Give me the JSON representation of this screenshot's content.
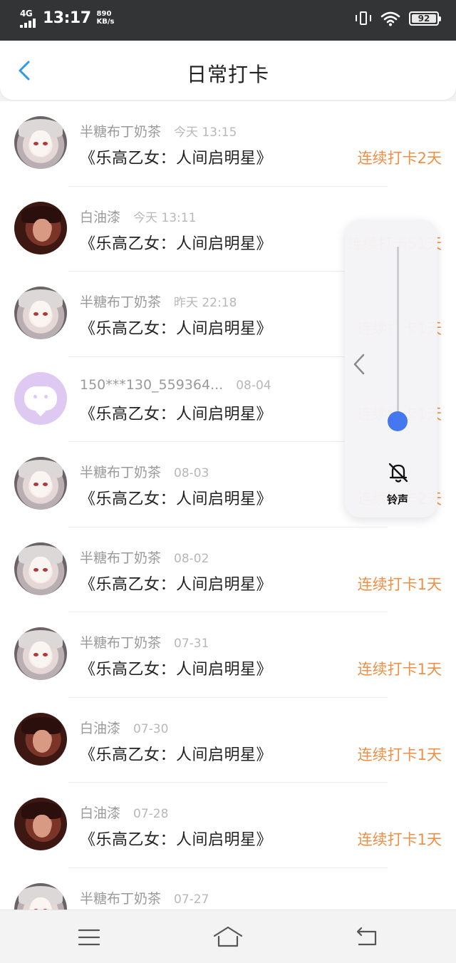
{
  "status_bar": {
    "network": "4G",
    "time": "13:17",
    "speed_value": "890",
    "speed_unit": "KB/s",
    "battery": "92"
  },
  "header": {
    "title": "日常打卡",
    "back_icon": "chevron-left-icon"
  },
  "checkins": [
    {
      "name": "半糖布丁奶茶",
      "time": "今天 13:15",
      "work": "《乐高乙女：人间启明星》",
      "streak": "连续打卡2天",
      "avatar": "a1"
    },
    {
      "name": "白油漆",
      "time": "今天 13:11",
      "work": "《乐高乙女：人间启明星》",
      "streak": "连续打卡51天",
      "avatar": "a2"
    },
    {
      "name": "半糖布丁奶茶",
      "time": "昨天 22:18",
      "work": "《乐高乙女：人间启明星》",
      "streak": "连续打卡1天",
      "avatar": "a1"
    },
    {
      "name": "150***130_559364...",
      "time": "08-04",
      "work": "《乐高乙女：人间启明星》",
      "streak": "连续打卡1天",
      "avatar": "a3"
    },
    {
      "name": "半糖布丁奶茶",
      "time": "08-03",
      "work": "《乐高乙女：人间启明星》",
      "streak": "连续打卡2天",
      "avatar": "a1"
    },
    {
      "name": "半糖布丁奶茶",
      "time": "08-02",
      "work": "《乐高乙女：人间启明星》",
      "streak": "连续打卡1天",
      "avatar": "a1"
    },
    {
      "name": "半糖布丁奶茶",
      "time": "07-31",
      "work": "《乐高乙女：人间启明星》",
      "streak": "连续打卡1天",
      "avatar": "a1"
    },
    {
      "name": "白油漆",
      "time": "07-30",
      "work": "《乐高乙女：人间启明星》",
      "streak": "连续打卡1天",
      "avatar": "a2"
    },
    {
      "name": "白油漆",
      "time": "07-28",
      "work": "《乐高乙女：人间启明星》",
      "streak": "连续打卡1天",
      "avatar": "a2"
    },
    {
      "name": "半糖布丁奶茶",
      "time": "07-27",
      "work": "",
      "streak": "",
      "avatar": "a1"
    }
  ],
  "volume_panel": {
    "label": "铃声",
    "level": 0.05,
    "icon": "bell-off-icon",
    "collapse_icon": "chevron-left-icon"
  },
  "nav_bar": {
    "icons": [
      "menu-icon",
      "home-icon",
      "back-icon"
    ]
  },
  "colors": {
    "accent": "#2e9be6",
    "streak": "#ee8f46",
    "slider": "#4577ee"
  }
}
